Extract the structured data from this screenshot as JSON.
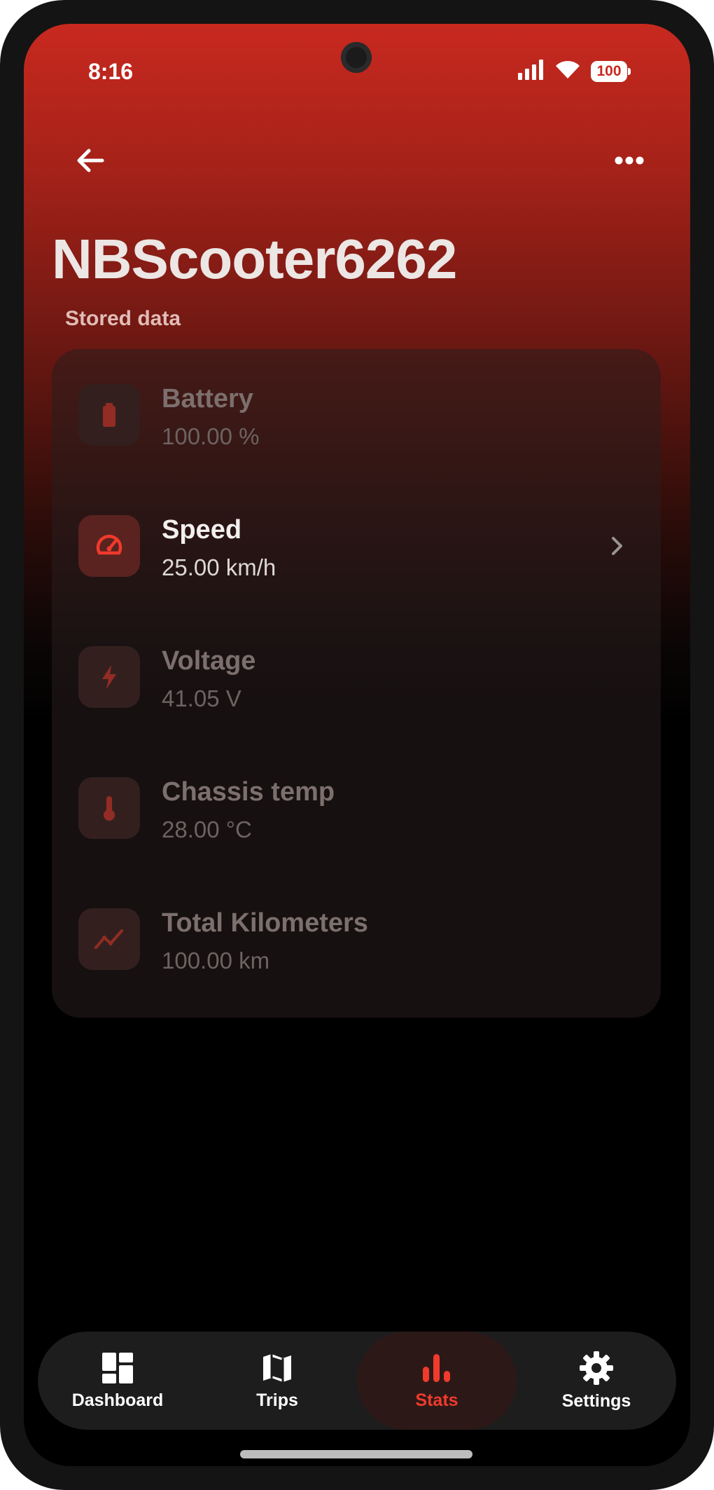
{
  "status_bar": {
    "time": "8:16",
    "battery_level": "100",
    "icons": [
      "signal-icon",
      "wifi-icon",
      "battery-icon"
    ]
  },
  "header": {
    "back_icon": "arrow-left-icon",
    "more_icon": "more-horizontal-icon",
    "title": "NBScooter6262"
  },
  "stored_data": {
    "label": "Stored data",
    "items": [
      {
        "title": "Battery",
        "value": "100.00 %",
        "icon": "battery-icon"
      },
      {
        "title": "Speed",
        "value": "25.00 km/h",
        "icon": "speedometer-icon"
      },
      {
        "title": "Voltage",
        "value": "41.05 V",
        "icon": "lightning-icon"
      },
      {
        "title": "Chassis temp",
        "value": "28.00 °C",
        "icon": "thermometer-icon"
      },
      {
        "title": "Total Kilometers",
        "value": "100.00 km",
        "icon": "trend-line-icon"
      }
    ]
  },
  "bottom_nav": {
    "items": [
      {
        "label": "Dashboard",
        "icon": "dashboard-icon"
      },
      {
        "label": "Trips",
        "icon": "map-icon"
      },
      {
        "label": "Stats",
        "icon": "bar-chart-icon"
      },
      {
        "label": "Settings",
        "icon": "gear-icon"
      }
    ],
    "active": "Stats"
  },
  "colors": {
    "accent": "#ef3a2c",
    "header_red": "#c8291f",
    "background": "#000000"
  }
}
